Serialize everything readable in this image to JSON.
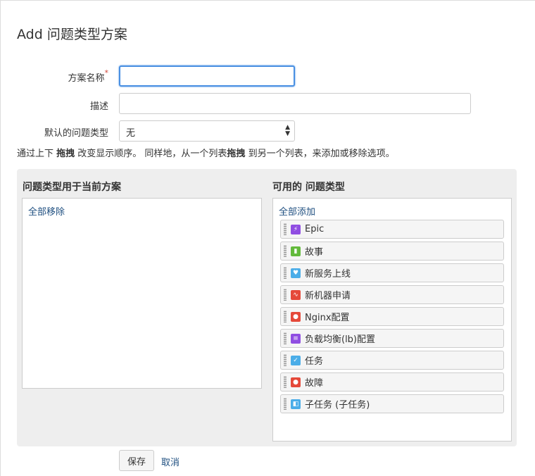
{
  "page": {
    "title": "Add 问题类型方案"
  },
  "form": {
    "name_label": "方案名称",
    "required_mark": "*",
    "name_value": "",
    "desc_label": "描述",
    "desc_value": "",
    "default_label": "默认的问题类型",
    "default_value": "无"
  },
  "help": {
    "part1": "通过上下 ",
    "bold1": "拖拽",
    "part2": " 改变显示顺序。 同样地，从一个列表",
    "bold2": "拖拽",
    "part3": " 到另一个列表，来添加或移除选项。"
  },
  "left": {
    "title": "问题类型用于当前方案",
    "remove_all": "全部移除"
  },
  "right": {
    "title": "可用的 问题类型",
    "add_all": "全部添加",
    "items": [
      {
        "label": "Epic",
        "icon": "epic-icon",
        "color": "#904ee2",
        "glyph": "⚡"
      },
      {
        "label": "故事",
        "icon": "story-icon",
        "color": "#63ba3c",
        "glyph": "▮"
      },
      {
        "label": "新服务上线",
        "icon": "heart-icon",
        "color": "#4bade8",
        "glyph": "♥"
      },
      {
        "label": "新机器申请",
        "icon": "pulse-icon",
        "color": "#e5493a",
        "glyph": "∿"
      },
      {
        "label": "Nginx配置",
        "icon": "bug-icon",
        "color": "#e5493a",
        "glyph": "●"
      },
      {
        "label": "负载均衡(lb)配置",
        "icon": "document-icon",
        "color": "#904ee2",
        "glyph": "≡"
      },
      {
        "label": "任务",
        "icon": "checkbox-icon",
        "color": "#4bade8",
        "glyph": "✓"
      },
      {
        "label": "故障",
        "icon": "bug-icon",
        "color": "#e5493a",
        "glyph": "●"
      },
      {
        "label": "子任务 (子任务)",
        "icon": "subtask-icon",
        "color": "#4bade8",
        "glyph": "◧"
      }
    ]
  },
  "actions": {
    "save": "保存",
    "cancel": "取消"
  }
}
